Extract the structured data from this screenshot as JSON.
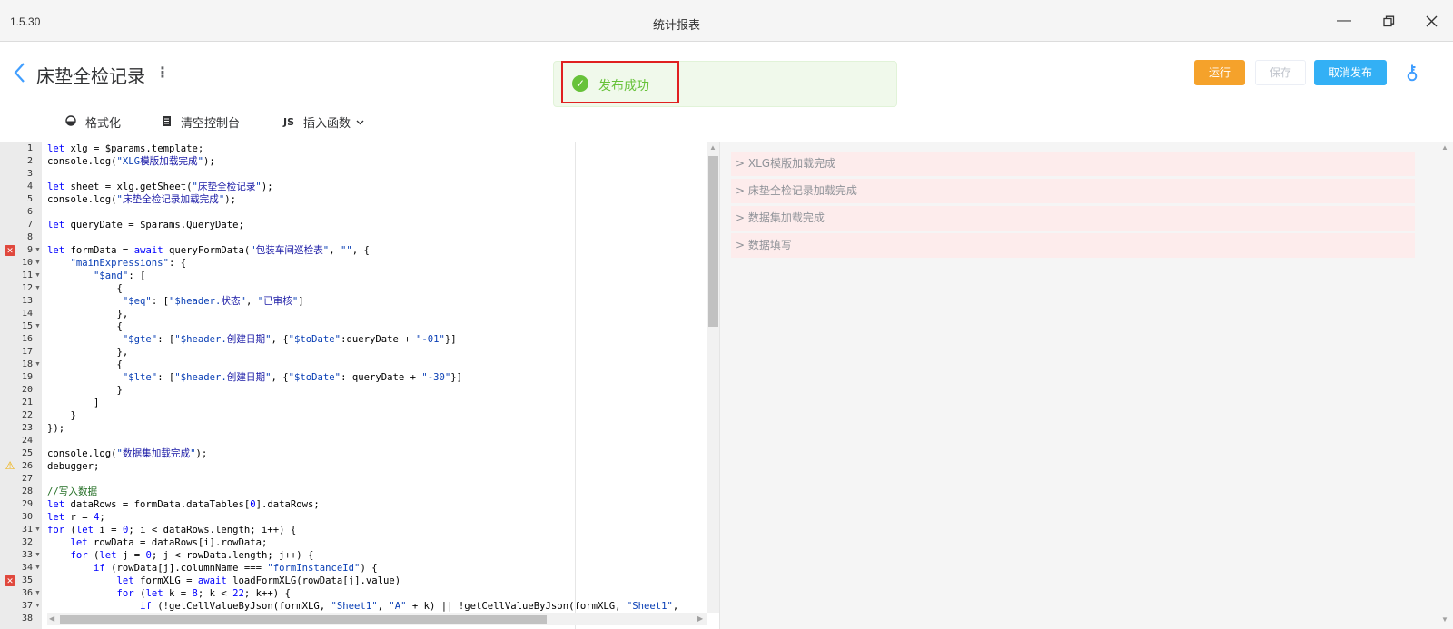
{
  "window": {
    "version": "1.5.30",
    "title": "统计报表"
  },
  "header": {
    "title": "床垫全检记录"
  },
  "toast": {
    "message": "发布成功"
  },
  "actions": {
    "run": "运行",
    "save": "保存",
    "unpublish": "取消发布"
  },
  "toolbar": {
    "format": "格式化",
    "clear_console": "清空控制台",
    "js_badge": "JS",
    "insert_function": "插入函数"
  },
  "editor": {
    "lines": [
      {
        "n": "1",
        "code": "let xlg = $params.template;"
      },
      {
        "n": "2",
        "code": "console.log(\"XLG模版加载完成\");"
      },
      {
        "n": "3",
        "code": ""
      },
      {
        "n": "4",
        "code": "let sheet = xlg.getSheet(\"床垫全检记录\");"
      },
      {
        "n": "5",
        "code": "console.log(\"床垫全检记录加载完成\");"
      },
      {
        "n": "6",
        "code": ""
      },
      {
        "n": "7",
        "code": "let queryDate = $params.QueryDate;"
      },
      {
        "n": "8",
        "code": ""
      },
      {
        "n": "9",
        "code": "let formData = await queryFormData(\"包装车间巡检表\", \"\", {"
      },
      {
        "n": "10",
        "code": "    \"mainExpressions\": {"
      },
      {
        "n": "11",
        "code": "        \"$and\": ["
      },
      {
        "n": "12",
        "code": "            {"
      },
      {
        "n": "13",
        "code": "             \"$eq\": [\"$header.状态\", \"已审核\"]"
      },
      {
        "n": "14",
        "code": "            },"
      },
      {
        "n": "15",
        "code": "            {"
      },
      {
        "n": "16",
        "code": "             \"$gte\": [\"$header.创建日期\", {\"$toDate\":queryDate + \"-01\"}]"
      },
      {
        "n": "17",
        "code": "            },"
      },
      {
        "n": "18",
        "code": "            {"
      },
      {
        "n": "19",
        "code": "             \"$lte\": [\"$header.创建日期\", {\"$toDate\": queryDate + \"-30\"}]"
      },
      {
        "n": "20",
        "code": "            }"
      },
      {
        "n": "21",
        "code": "        ]"
      },
      {
        "n": "22",
        "code": "    }"
      },
      {
        "n": "23",
        "code": "});"
      },
      {
        "n": "24",
        "code": ""
      },
      {
        "n": "25",
        "code": "console.log(\"数据集加载完成\");"
      },
      {
        "n": "26",
        "code": "debugger;"
      },
      {
        "n": "27",
        "code": ""
      },
      {
        "n": "28",
        "code": "//写入数据"
      },
      {
        "n": "29",
        "code": "let dataRows = formData.dataTables[0].dataRows;"
      },
      {
        "n": "30",
        "code": "let r = 4;"
      },
      {
        "n": "31",
        "code": "for (let i = 0; i < dataRows.length; i++) {"
      },
      {
        "n": "32",
        "code": "    let rowData = dataRows[i].rowData;"
      },
      {
        "n": "33",
        "code": "    for (let j = 0; j < rowData.length; j++) {"
      },
      {
        "n": "34",
        "code": "        if (rowData[j].columnName === \"formInstanceId\") {"
      },
      {
        "n": "35",
        "code": "            let formXLG = await loadFormXLG(rowData[j].value)"
      },
      {
        "n": "36",
        "code": "            for (let k = 8; k < 22; k++) {"
      },
      {
        "n": "37",
        "code": "                if (!getCellValueByJson(formXLG, \"Sheet1\", \"A\" + k) || !getCellValueByJson(formXLG, \"Sheet1\","
      },
      {
        "n": "38",
        "code": ""
      }
    ],
    "fold_lines": [
      "9",
      "10",
      "11",
      "12",
      "15",
      "18",
      "31",
      "33",
      "34",
      "36",
      "37"
    ],
    "error_lines": [
      "9",
      "35"
    ],
    "warning_lines": [
      "26"
    ]
  },
  "console": {
    "logs": [
      "> XLG模版加载完成",
      "> 床垫全检记录加载完成",
      "> 数据集加载完成",
      "> 数据填写"
    ]
  },
  "colors": {
    "keyword": "#0000ff",
    "string": "#0a3fb5",
    "cjk": "#1a1aa6",
    "comment": "#236e24",
    "run": "#f5a22b",
    "unpublish": "#33b0f5",
    "success": "#67c23a"
  }
}
